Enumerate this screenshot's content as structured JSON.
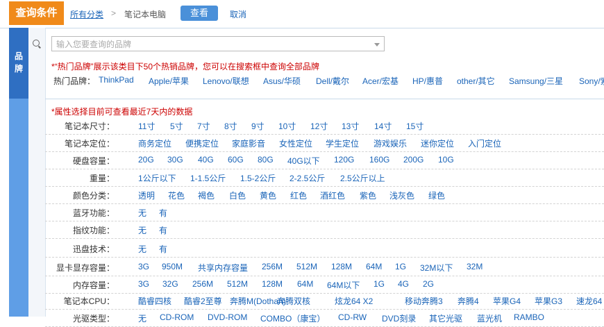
{
  "header": {
    "query_tab": "查询条件",
    "breadcrumb_all": "所有分类",
    "breadcrumb_sep": ">",
    "breadcrumb_current": "笔记本电脑",
    "view_button": "查看",
    "cancel_button": "取消"
  },
  "brand": {
    "section_label": "品牌",
    "select_placeholder": "输入您要查询的品牌",
    "note": "*“热门品牌”展示该类目下50个热销品牌，您可以在搜索框中查询全部品牌",
    "hot_label": "热门品牌：",
    "hot_items": [
      "ThinkPad",
      "Apple/苹果",
      "Lenovo/联想",
      "Asus/华硕",
      "Dell/戴尔",
      "Acer/宏基",
      "HP/惠普",
      "other/其它",
      "Samsung/三星",
      "Sony/索"
    ]
  },
  "attributes": {
    "note": "*属性选择目前可查看最近7天内的数据",
    "rows": [
      {
        "label": "笔记本尺寸：",
        "options": [
          "11寸",
          "5寸",
          "7寸",
          "8寸",
          "9寸",
          "10寸",
          "12寸",
          "13寸",
          "14寸",
          "15寸"
        ]
      },
      {
        "label": "笔记本定位：",
        "options": [
          "商务定位",
          "便携定位",
          "家庭影音",
          "女性定位",
          "学生定位",
          "游戏娱乐",
          "迷你定位",
          "入门定位"
        ]
      },
      {
        "label": "硬盘容量：",
        "options": [
          "20G",
          "30G",
          "40G",
          "60G",
          "80G",
          "40G以下",
          "120G",
          "160G",
          "200G",
          "10G"
        ]
      },
      {
        "label": "重量：",
        "options": [
          "1公斤以下",
          "1-1.5公斤",
          "1.5-2公斤",
          "2-2.5公斤",
          "2.5公斤以上"
        ]
      },
      {
        "label": "颜色分类：",
        "options": [
          "透明",
          "花色",
          "褐色",
          "白色",
          "黄色",
          "红色",
          "酒红色",
          "紫色",
          "浅灰色",
          "绿色"
        ]
      },
      {
        "label": "蓝牙功能：",
        "options": [
          "无",
          "有"
        ]
      },
      {
        "label": "指纹功能：",
        "options": [
          "无",
          "有"
        ]
      },
      {
        "label": "迅盘技术：",
        "options": [
          "无",
          "有"
        ]
      },
      {
        "label": "显卡显存容量：",
        "options": [
          "3G",
          "950M",
          "共享内存容量",
          "256M",
          "512M",
          "128M",
          "64M",
          "1G",
          "32M以下",
          "32M"
        ]
      },
      {
        "label": "内存容量：",
        "options": [
          "3G",
          "32G",
          "256M",
          "512M",
          "128M",
          "64M",
          "64M以下",
          "1G",
          "4G",
          "2G"
        ]
      },
      {
        "label": "笔记本CPU：",
        "options": [
          "酷睿四核",
          "酷睿2至尊",
          "奔腾M(Dothan)",
          "奔腾双核",
          "炫龙64 X2",
          "移动奔腾3",
          "奔腾4",
          "苹果G4",
          "苹果G3",
          "速龙64"
        ]
      },
      {
        "label": "光驱类型：",
        "options": [
          "无",
          "CD-ROM",
          "DVD-ROM",
          "COMBO（康宝）",
          "CD-RW",
          "DVD刻录",
          "其它光驱",
          "蓝光机",
          "RAMBO"
        ]
      }
    ]
  }
}
